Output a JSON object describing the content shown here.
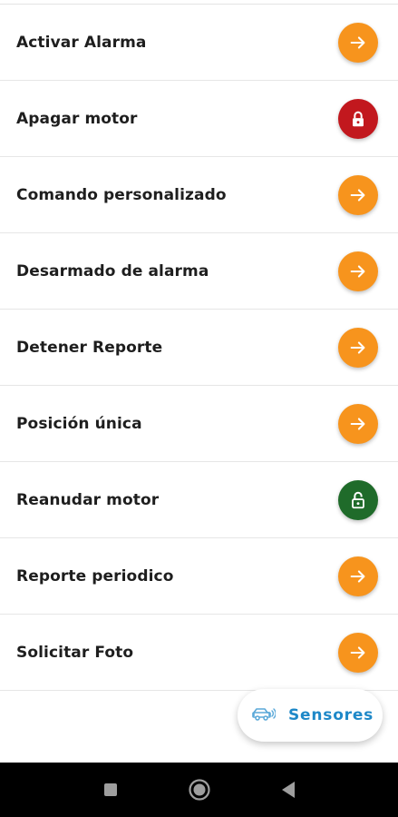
{
  "colors": {
    "orange": "#f7941d",
    "red": "#c2181e",
    "green": "#1f6b2a",
    "accent_blue": "#1e88c8"
  },
  "commands": [
    {
      "label": "Activar Alarma",
      "icon": "arrow-right-icon",
      "color": "#f7941d"
    },
    {
      "label": "Apagar motor",
      "icon": "lock-closed-icon",
      "color": "#c2181e"
    },
    {
      "label": "Comando personalizado",
      "icon": "arrow-right-icon",
      "color": "#f7941d"
    },
    {
      "label": "Desarmado de alarma",
      "icon": "arrow-right-icon",
      "color": "#f7941d"
    },
    {
      "label": "Detener Reporte",
      "icon": "arrow-right-icon",
      "color": "#f7941d"
    },
    {
      "label": "Posición única",
      "icon": "arrow-right-icon",
      "color": "#f7941d"
    },
    {
      "label": "Reanudar motor",
      "icon": "lock-open-icon",
      "color": "#1f6b2a"
    },
    {
      "label": "Reporte periodico",
      "icon": "arrow-right-icon",
      "color": "#f7941d"
    },
    {
      "label": "Solicitar Foto",
      "icon": "arrow-right-icon",
      "color": "#f7941d"
    }
  ],
  "fab": {
    "label": "Sensores",
    "icon": "vehicle-sensor-icon"
  },
  "nav": {
    "icons": [
      "recents-icon",
      "home-icon",
      "back-icon"
    ]
  }
}
